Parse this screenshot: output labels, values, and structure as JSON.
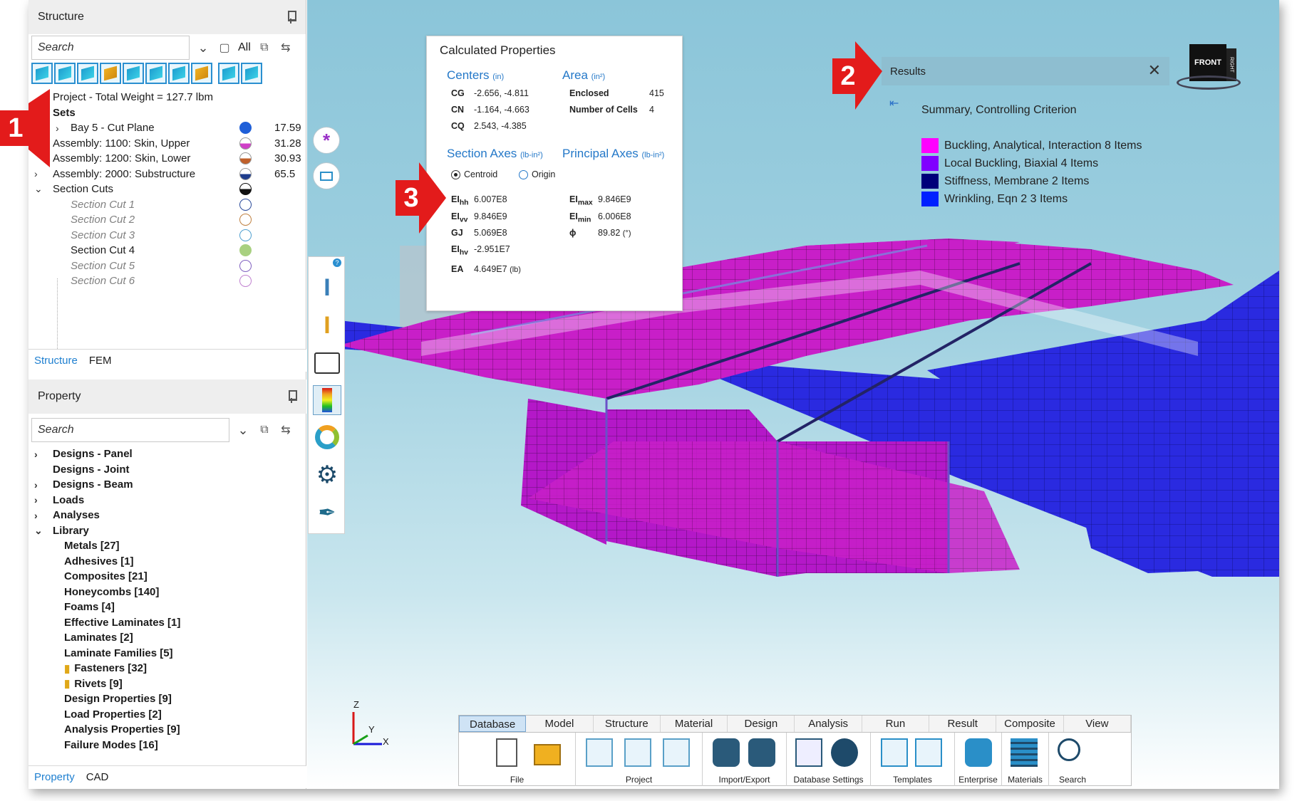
{
  "structure_panel": {
    "title": "Structure",
    "search_placeholder": "Search",
    "all_label": "All",
    "tree": {
      "project": "Project - Total Weight = 127.7 lbm",
      "sets": "Sets",
      "bay5": {
        "label": "Bay 5 - Cut Plane",
        "value": "17.59"
      },
      "asm1100": {
        "label": "Assembly: 1100: Skin, Upper",
        "value": "31.28"
      },
      "asm1200": {
        "label": "Assembly: 1200: Skin, Lower",
        "value": "30.93"
      },
      "asm2000": {
        "label": "Assembly: 2000: Substructure",
        "value": "65.5"
      },
      "section_cuts": "Section Cuts",
      "cuts": [
        "Section Cut 1",
        "Section Cut 2",
        "Section Cut 3",
        "Section Cut 4",
        "Section Cut 5",
        "Section Cut 6"
      ]
    },
    "tabs": [
      "Structure",
      "FEM"
    ]
  },
  "property_panel": {
    "title": "Property",
    "search_placeholder": "Search",
    "items": [
      "Designs - Panel",
      "Designs - Joint",
      "Designs - Beam",
      "Loads",
      "Analyses",
      "Library"
    ],
    "library": [
      "Metals [27]",
      "Adhesives [1]",
      "Composites [21]",
      "Honeycombs [140]",
      "Foams [4]",
      "Effective Laminates [1]",
      "Laminates [2]",
      "Laminate Families [5]",
      "Fasteners [32]",
      "Rivets [9]",
      "Design Properties [9]",
      "Load Properties [2]",
      "Analysis Properties [9]",
      "Failure Modes [16]"
    ],
    "tabs": [
      "Property",
      "CAD"
    ]
  },
  "calc_props": {
    "title": "Calculated Properties",
    "centers": "Centers",
    "centers_unit": "(in)",
    "area": "Area",
    "area_unit": "(in²)",
    "cg_k": "CG",
    "cg_v": "-2.656, -4.811",
    "cn_k": "CN",
    "cn_v": "-1.164, -4.663",
    "cq_k": "CQ",
    "cq_v": "2.543, -4.385",
    "enclosed_k": "Enclosed",
    "enclosed_v": "415",
    "cells_k": "Number of Cells",
    "cells_v": "4",
    "section_axes": "Section Axes",
    "section_unit": "(lb-in²)",
    "principal_axes": "Principal Axes",
    "principal_unit": "(lb-in²)",
    "centroid": "Centroid",
    "origin": "Origin",
    "eihh_v": "6.007E8",
    "eivv_v": "9.846E9",
    "gj_k": "GJ",
    "gj_v": "5.069E8",
    "eihv_v": "-2.951E7",
    "ea_k": "EA",
    "ea_v": "4.649E7",
    "ea_unit": "(lb)",
    "eimax_v": "9.846E9",
    "eimin_v": "6.006E8",
    "phi_k": "ϕ",
    "phi_v": "89.82",
    "phi_unit": "(°)"
  },
  "results": {
    "title": "Results",
    "summary": "Summary, Controlling Criterion",
    "legend": [
      {
        "label": "Buckling, Analytical, Interaction 8 Items",
        "color": "#ff00ff"
      },
      {
        "label": "Local Buckling, Biaxial 4 Items",
        "color": "#8000ff"
      },
      {
        "label": "Stiffness, Membrane 2 Items",
        "color": "#00007a"
      },
      {
        "label": "Wrinkling, Eqn 2 3 Items",
        "color": "#0020ff"
      }
    ]
  },
  "ribbon": {
    "tabs": [
      "Database",
      "Model",
      "Structure",
      "Material",
      "Design",
      "Analysis",
      "Run",
      "Result",
      "Composite",
      "View"
    ],
    "groups": [
      "File",
      "Project",
      "Import/Export",
      "Database Settings",
      "Templates",
      "Enterprise",
      "Materials",
      "Search"
    ]
  },
  "view_cube": {
    "front": "FRONT",
    "right": "RIGHT"
  },
  "axes": {
    "z": "Z",
    "y": "Y",
    "x": "X"
  },
  "markers": [
    "1",
    "2",
    "3"
  ]
}
